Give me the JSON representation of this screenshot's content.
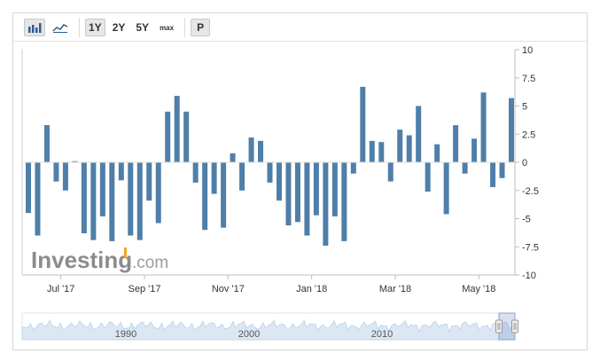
{
  "toolbar": {
    "icons": [
      "bar-chart-icon",
      "line-chart-icon"
    ],
    "ranges": [
      "1Y",
      "2Y",
      "5Y",
      "max"
    ],
    "active_range": "1Y",
    "p_label": "P"
  },
  "watermark": {
    "brand": "Investing",
    "suffix": ".com"
  },
  "colors": {
    "bar": "#4f7fa8",
    "accent_orange": "#f5a623",
    "navigator_fill": "#dbe7f3"
  },
  "chart_data": {
    "type": "bar",
    "categories": [
      "1",
      "2",
      "3",
      "4",
      "5",
      "6",
      "7",
      "8",
      "9",
      "10",
      "11",
      "12",
      "13",
      "14",
      "15",
      "16",
      "17",
      "18",
      "19",
      "20",
      "21",
      "22",
      "23",
      "24",
      "25",
      "26",
      "27",
      "28",
      "29",
      "30",
      "31",
      "32",
      "33",
      "34",
      "35",
      "36",
      "37",
      "38",
      "39",
      "40",
      "41",
      "42",
      "43",
      "44",
      "45",
      "46",
      "47",
      "48",
      "49",
      "50",
      "51",
      "52",
      "53"
    ],
    "values": [
      -4.5,
      -6.5,
      3.3,
      -1.7,
      -2.5,
      0.1,
      -6.3,
      -6.9,
      -4.8,
      -7.0,
      -1.6,
      -6.5,
      -6.9,
      -3.4,
      -5.4,
      4.5,
      5.9,
      4.5,
      -1.8,
      -6.0,
      -2.8,
      -5.8,
      0.8,
      -2.5,
      2.2,
      1.9,
      -1.8,
      -3.4,
      -5.6,
      -5.3,
      -6.5,
      -4.7,
      -7.4,
      -4.8,
      -7.0,
      -1.0,
      6.7,
      1.9,
      1.8,
      -1.7,
      2.9,
      2.4,
      5.0,
      -2.6,
      1.6,
      -4.6,
      3.3,
      -1.0,
      2.1,
      6.2,
      -2.2,
      -1.4,
      5.7
    ],
    "ylim": [
      -10,
      10
    ],
    "yticks": [
      "10",
      "7.5",
      "5",
      "2.5",
      "0",
      "-2.5",
      "-5",
      "-7.5",
      "-10"
    ],
    "xtick_labels": [
      "Jul '17",
      "Sep '17",
      "Nov '17",
      "Jan '18",
      "Mar '18",
      "May '18"
    ],
    "xtick_positions": [
      3.5,
      12.5,
      21.5,
      30.5,
      39.5,
      48.5
    ],
    "grid": false,
    "navigator": {
      "labels": [
        "1990",
        "2000",
        "2010"
      ]
    }
  }
}
